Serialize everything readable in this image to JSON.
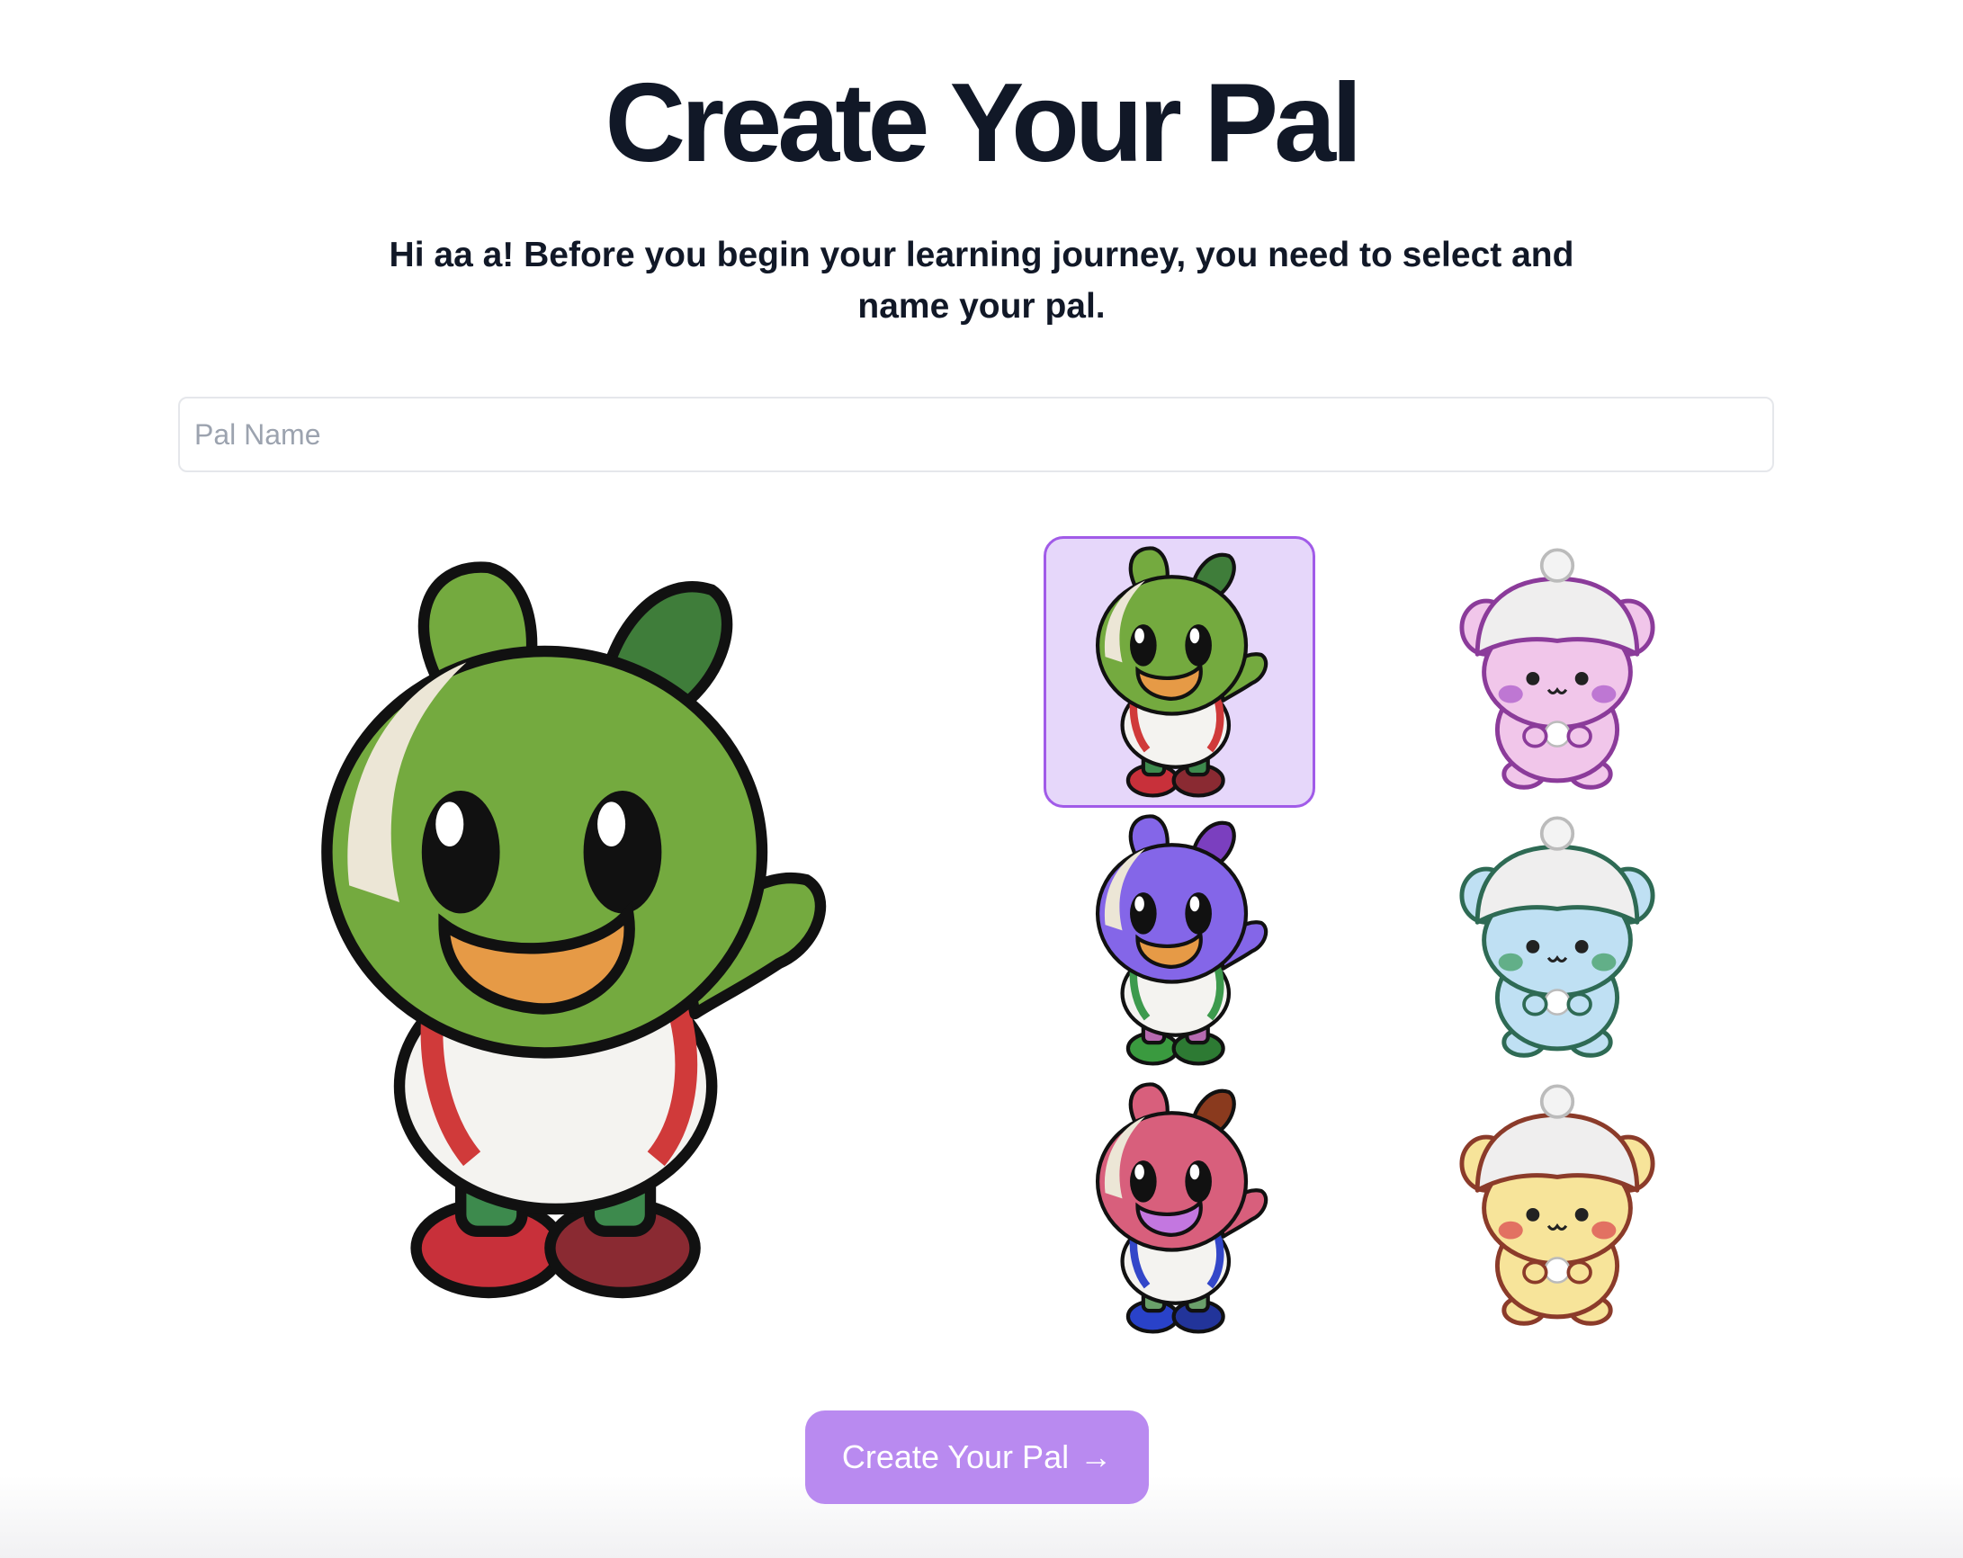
{
  "header": {
    "title": "Create Your Pal",
    "subtitle": "Hi aa a! Before you begin your learning journey, you need to select and name your pal."
  },
  "form": {
    "name_placeholder": "Pal Name",
    "name_value": ""
  },
  "pals": [
    {
      "kind": "sprout",
      "selected": true,
      "head": "#74aa3f",
      "shade": "#3f7d3a",
      "mouth": "#e69a46",
      "strap": "#d03a3a",
      "shoe": "#c8303a",
      "shoe2": "#8a2a32",
      "pants": "#3d8a4d"
    },
    {
      "kind": "bear",
      "selected": false,
      "body": "#f1c6ea",
      "edge": "#8b3b9a",
      "cheek": "#a855c9"
    },
    {
      "kind": "sprout",
      "selected": false,
      "head": "#8466e8",
      "shade": "#7b3fbf",
      "mouth": "#e69a46",
      "strap": "#3d9a4d",
      "shoe": "#3a9a3f",
      "shoe2": "#2d7a33",
      "pants": "#b66ab0"
    },
    {
      "kind": "bear",
      "selected": false,
      "body": "#bfe0f3",
      "edge": "#2e6a54",
      "cheek": "#3a9a5a"
    },
    {
      "kind": "sprout",
      "selected": false,
      "head": "#d85f7c",
      "shade": "#8a3a1e",
      "mouth": "#c377e0",
      "strap": "#3347c9",
      "shoe": "#2942c9",
      "shoe2": "#22349a",
      "pants": "#6aa06a"
    },
    {
      "kind": "bear",
      "selected": false,
      "body": "#f7e49a",
      "edge": "#8b3b2a",
      "cheek": "#d8404a"
    }
  ],
  "actions": {
    "create_label": "Create Your Pal",
    "create_icon": "arrow-right-icon"
  }
}
